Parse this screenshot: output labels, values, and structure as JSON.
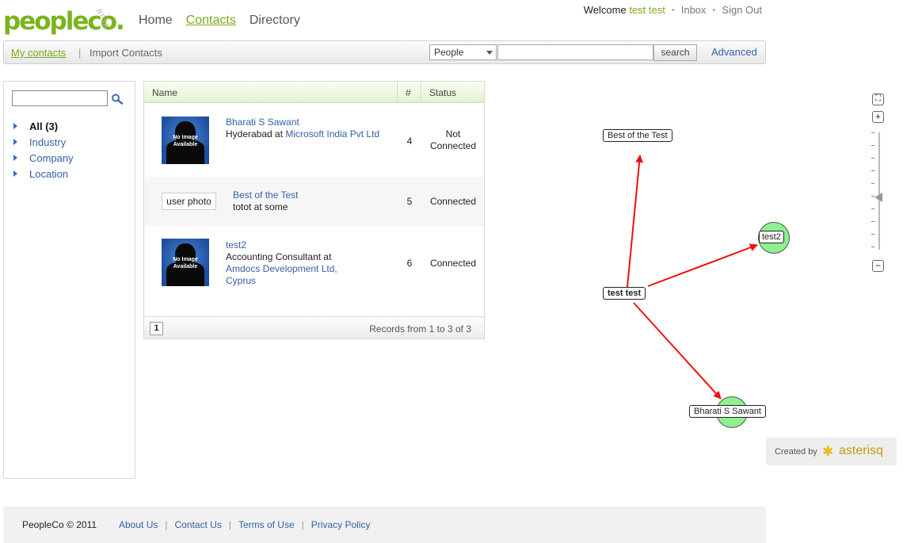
{
  "brand": {
    "name": "peopleco",
    "dot": ".",
    "beta": "BETA",
    "color": "#78ab1a"
  },
  "nav": {
    "home": "Home",
    "contacts": "Contacts",
    "directory": "Directory"
  },
  "user": {
    "welcome": "Welcome",
    "name": "test test",
    "inbox": "Inbox",
    "signout": "Sign Out",
    "separator": "•"
  },
  "toolbar": {
    "my_contacts": "My contacts",
    "pipe": "|",
    "import_contacts": "Import Contacts",
    "search_scope": "People",
    "search_value": "",
    "search_button": "search",
    "advanced": "Advanced"
  },
  "sidebar": {
    "filter_value": "",
    "items": [
      {
        "label": "All (3)"
      },
      {
        "label": "Industry"
      },
      {
        "label": "Company"
      },
      {
        "label": "Location"
      }
    ]
  },
  "table": {
    "columns": {
      "name": "Name",
      "num": "#",
      "status": "Status"
    },
    "rows": [
      {
        "photo": "No Image Available",
        "name": "Bharati S Sawant",
        "title": "Hyderabad at",
        "company": "Microsoft India Pvt Ltd",
        "num": "4",
        "status_line1": "Not",
        "status_line2": "Connected"
      },
      {
        "photo": "user photo",
        "name": "Best of the Test",
        "title": "totot at some",
        "company": "",
        "num": "5",
        "status_line1": "Connected",
        "status_line2": ""
      },
      {
        "photo": "No Image Available",
        "name": "test2",
        "title": "Accounting Consultant at",
        "company": "Amdocs Development Ltd, Cyprus",
        "num": "6",
        "status_line1": "Connected",
        "status_line2": ""
      }
    ],
    "page": "1",
    "records": "Records from 1 to 3 of 3"
  },
  "graph": {
    "nodes": {
      "center": "test test",
      "top": "Best of the Test",
      "right": "test2",
      "bottom": "Bharati S  Sawant"
    },
    "edge_color": "#ee1111",
    "node_fill": "#8ef08e"
  },
  "zoom": {
    "fit": "⛶",
    "plus": "+",
    "minus": "−"
  },
  "created_by": {
    "label": "Created by",
    "brand": "asterisq"
  },
  "footer": {
    "copyright": "PeopleCo © 2011",
    "links": [
      "About Us",
      "Contact Us",
      "Terms of Use",
      "Privacy Policy"
    ],
    "sep": "|"
  }
}
